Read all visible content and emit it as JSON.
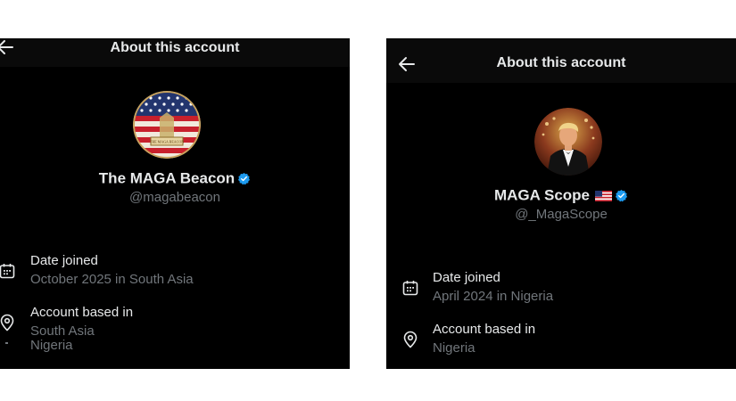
{
  "left": {
    "header_title": "About this account",
    "display_name": "The MAGA Beacon",
    "handle": "@magabeacon",
    "date_joined_label": "Date joined",
    "date_joined_value": "October 2025 in South Asia",
    "account_based_label": "Account based in",
    "account_based_value": "South Asia",
    "overlap_text": "Nigeria",
    "avatar_banner_text": "THE MAGA BEACON"
  },
  "right": {
    "header_title": "About this account",
    "display_name": "MAGA Scope",
    "handle": "@_MagaScope",
    "date_joined_label": "Date joined",
    "date_joined_value": "April 2024 in Nigeria",
    "account_based_label": "Account based in",
    "account_based_value": "Nigeria"
  },
  "icons": {
    "back": "arrow-left-icon",
    "verified": "verified-badge-icon",
    "calendar": "calendar-icon",
    "location": "location-pin-icon",
    "flag": "us-flag-emoji"
  },
  "colors": {
    "background": "#000000",
    "primary_text": "#e7e9ea",
    "secondary_text": "#71767b",
    "verified_blue": "#1d9bf0"
  }
}
